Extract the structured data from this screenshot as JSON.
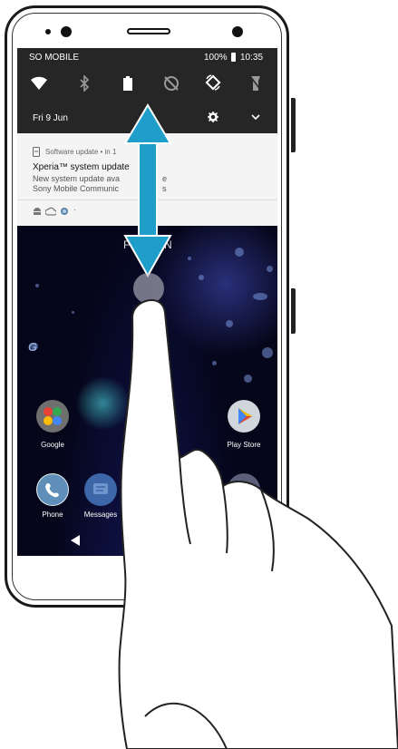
{
  "status_bar": {
    "carrier": "SO MOBILE",
    "battery": "100%",
    "time": "10:35"
  },
  "quick_settings": {
    "icons": [
      "wifi-icon",
      "bluetooth-icon",
      "flashlight-icon",
      "auto-rotate-off-icon",
      "auto-rotate-icon",
      "no-flash-icon"
    ],
    "date": "Fri 9 Jun"
  },
  "notification": {
    "source": "Software update • in 1",
    "title": "Xperia™ system update",
    "line1": "New system update ava",
    "line1_tail": "e",
    "line2": "Sony Mobile Communic",
    "line2_tail": "s",
    "dot": "·"
  },
  "lockscreen": {
    "date_partial": "FR    UN"
  },
  "apps": {
    "google": "Google",
    "play_store": "Play Store",
    "phone": "Phone",
    "messages": "Messages"
  },
  "colors": {
    "panel": "#262626",
    "notif_bg": "#f4f4f4",
    "arrow": "#1e9ec9"
  }
}
